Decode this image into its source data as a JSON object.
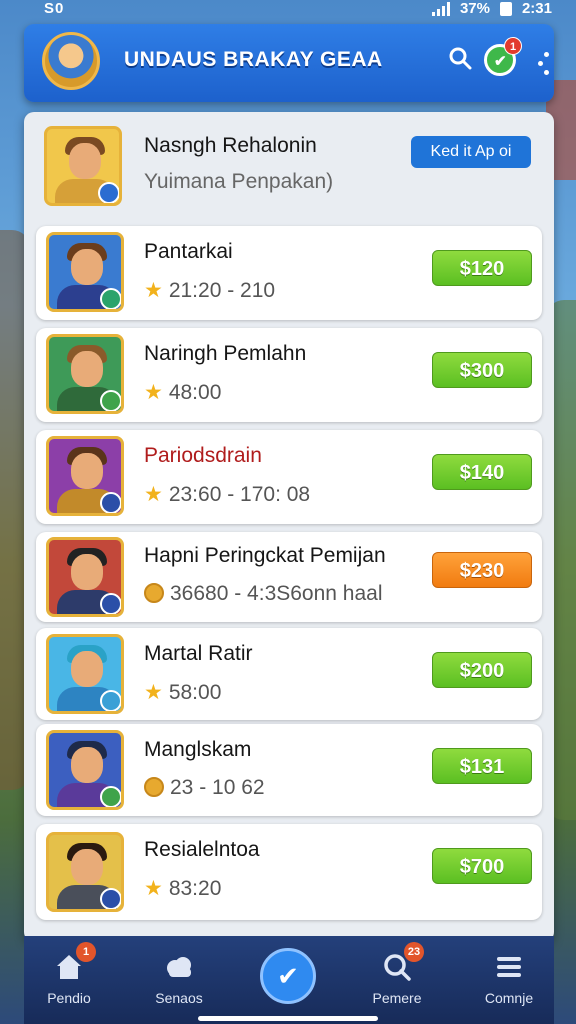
{
  "status_bar": {
    "left_text": "S0",
    "battery": "37%",
    "time": "2:31"
  },
  "header": {
    "title": "UNDAUS BRAKAY GEAA",
    "notification_count": "1"
  },
  "top_card": {
    "name": "Nasngh Rehalonin",
    "subtitle": "Yuimana Penpakan)",
    "action_label": "Ked it Ap oi"
  },
  "rows": [
    {
      "name": "Pantarkai",
      "meta": "21:20 - 210",
      "meta_icon": "star",
      "price": "$120",
      "price_color": "green"
    },
    {
      "name": "Naringh Pemlahn",
      "meta": "48:00",
      "meta_icon": "star",
      "price": "$300",
      "price_color": "green"
    },
    {
      "name": "Pariodsdrain",
      "meta": "23:60 - 170: 08",
      "meta_icon": "star",
      "price": "$140",
      "price_color": "green",
      "name_color": "#b01c1c"
    },
    {
      "name": "Hapni Peringckat Pemijan",
      "meta": "36680 - 4:3S6onn haal",
      "meta_icon": "coin",
      "price": "$230",
      "price_color": "orange"
    },
    {
      "name": "Martal Ratir",
      "meta": "58:00",
      "meta_icon": "star",
      "price": "$200",
      "price_color": "green"
    },
    {
      "name": "Manglskam",
      "meta": "23 - 10 62",
      "meta_icon": "coin",
      "price": "$131",
      "price_color": "green"
    },
    {
      "name": "Resialelntoa",
      "meta": "83:20",
      "meta_icon": "star",
      "price": "$700",
      "price_color": "green"
    }
  ],
  "nav": {
    "home": {
      "label": "Pendio",
      "badge": "1"
    },
    "scores": {
      "label": "Senaos"
    },
    "search": {
      "label": "Pemere",
      "badge": "23"
    },
    "menu": {
      "label": "Comnje"
    }
  },
  "colors": {
    "accent": "#1f74d8",
    "price_green": "#5bbf22",
    "price_orange": "#f17b10"
  }
}
